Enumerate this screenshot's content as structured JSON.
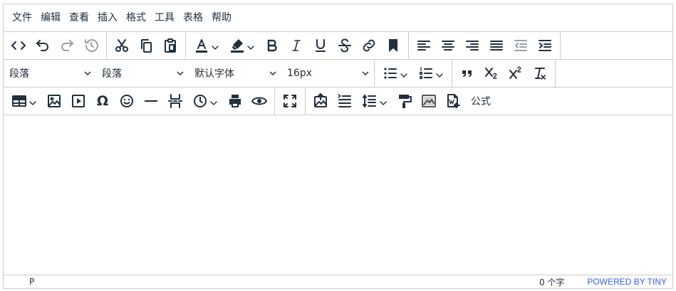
{
  "menubar": {
    "items": [
      "文件",
      "编辑",
      "查看",
      "插入",
      "格式",
      "工具",
      "表格",
      "帮助"
    ]
  },
  "toolbar": {
    "row1_icons": [
      "code-icon",
      "undo-icon",
      "redo-icon",
      "restore-draft-icon",
      "cut-icon",
      "copy-icon",
      "paste-icon",
      "text-color-icon",
      "highlight-color-icon",
      "bold-icon",
      "italic-icon",
      "underline-icon",
      "strikethrough-icon",
      "link-icon",
      "bookmark-icon",
      "align-left-icon",
      "align-center-icon",
      "align-right-icon",
      "align-justify-icon",
      "outdent-icon",
      "indent-icon"
    ],
    "blocks_select": "段落",
    "format_select": "段落",
    "font_family_select": "默认字体",
    "font_size_select": "16px",
    "row2_icons": [
      "bullet-list-icon",
      "numbered-list-icon",
      "blockquote-icon",
      "subscript-icon",
      "superscript-icon",
      "remove-format-icon"
    ],
    "row3_icons": [
      "table-icon",
      "image-icon",
      "media-icon",
      "special-char-icon",
      "emoticons-icon",
      "horizontal-rule-icon",
      "page-break-icon",
      "insert-datetime-icon",
      "print-icon",
      "preview-icon",
      "fullscreen-icon",
      "image-upload-icon",
      "line-indent-icon",
      "line-height-icon",
      "format-painter-icon",
      "image-gallery-icon",
      "import-word-icon"
    ],
    "formula_label": "公式"
  },
  "statusbar": {
    "path": "P",
    "word_count": "0 个字",
    "branding": "POWERED BY TINY"
  },
  "colors": {
    "border": "#cccccc",
    "icon": "#222f3e",
    "brand_link": "#335dff"
  }
}
